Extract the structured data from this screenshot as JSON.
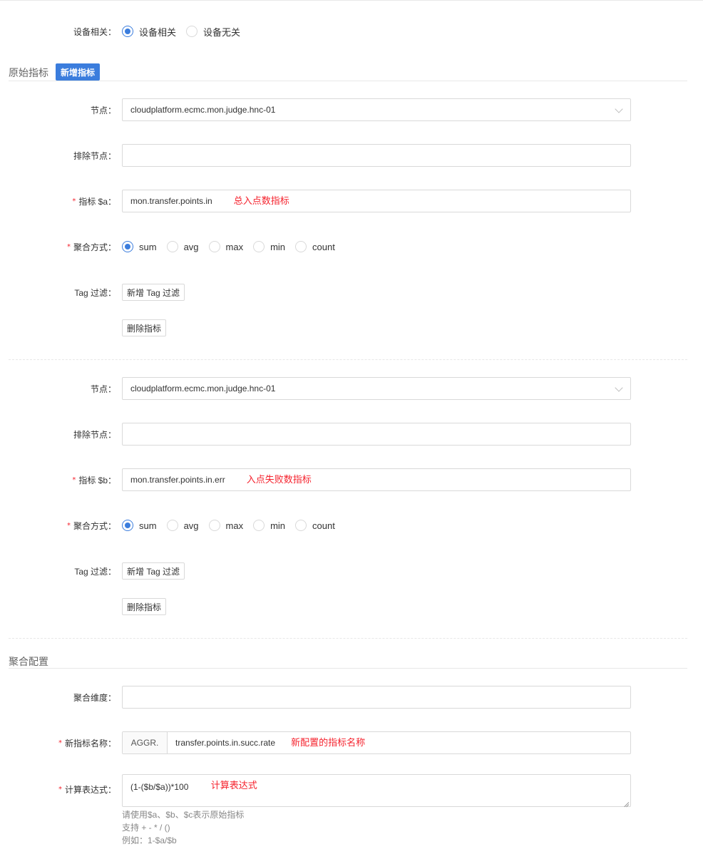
{
  "device": {
    "label": "设备相关：",
    "options": [
      "设备相关",
      "设备无关"
    ],
    "selected": 0
  },
  "raw_metrics": {
    "section_title": "原始指标",
    "add_button": "新增指标",
    "metrics": [
      {
        "node_label": "节点：",
        "node_value": "cloudplatform.ecmc.mon.judge.hnc-01",
        "exclude_label": "排除节点：",
        "exclude_value": "",
        "required_mark": "*",
        "metric_label": "指标 $a：",
        "metric_value": "mon.transfer.points.in",
        "metric_annotation": "总入点数指标",
        "agg_label": "聚合方式：",
        "agg_options": [
          "sum",
          "avg",
          "max",
          "min",
          "count"
        ],
        "agg_selected": 0,
        "tag_label": "Tag 过滤：",
        "tag_button": "新增 Tag 过滤",
        "delete_button": "删除指标"
      },
      {
        "node_label": "节点：",
        "node_value": "cloudplatform.ecmc.mon.judge.hnc-01",
        "exclude_label": "排除节点：",
        "exclude_value": "",
        "required_mark": "*",
        "metric_label": "指标 $b：",
        "metric_value": "mon.transfer.points.in.err",
        "metric_annotation": "入点失败数指标",
        "agg_label": "聚合方式：",
        "agg_options": [
          "sum",
          "avg",
          "max",
          "min",
          "count"
        ],
        "agg_selected": 0,
        "tag_label": "Tag 过滤：",
        "tag_button": "新增 Tag 过滤",
        "delete_button": "删除指标"
      }
    ]
  },
  "aggregation": {
    "section_title": "聚合配置",
    "dimension_label": "聚合维度：",
    "dimension_value": "",
    "required_mark": "*",
    "name_label": "新指标名称：",
    "name_prefix": "AGGR.",
    "name_value": "transfer.points.in.succ.rate",
    "name_annotation": "新配置的指标名称",
    "expr_label": "计算表达式：",
    "expr_value": "(1-($b/$a))*100",
    "expr_annotation": "计算表达式",
    "help": [
      "请使用$a、$b、$c表示原始指标",
      "支持 + - * / ()",
      "例如：1-$a/$b"
    ]
  },
  "colors": {
    "primary": "#3b7ddd",
    "required": "#f5222d",
    "border": "#d9d9d9"
  }
}
